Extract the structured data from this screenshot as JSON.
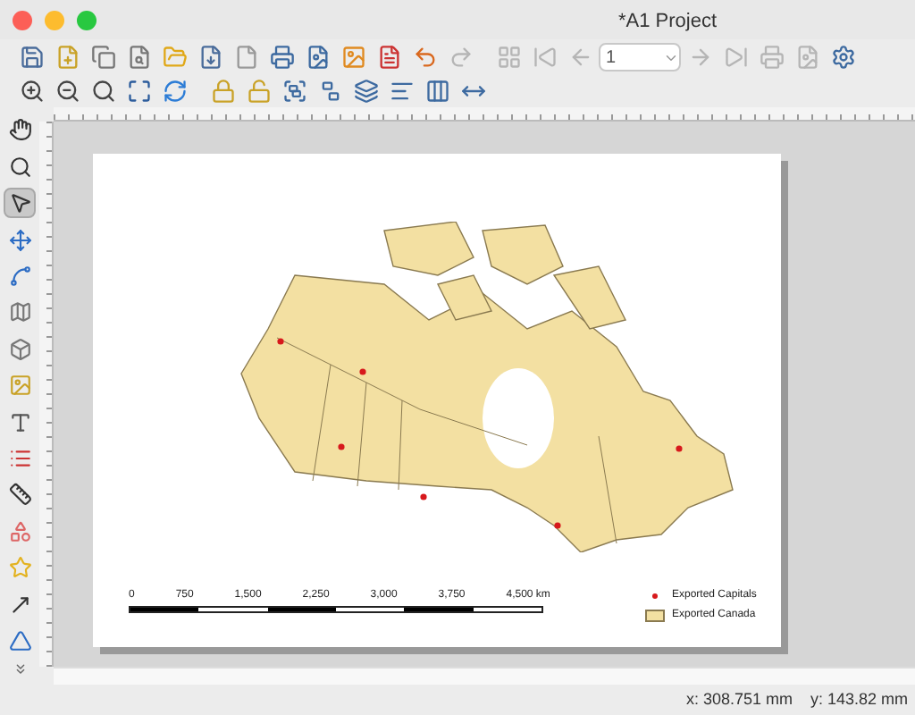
{
  "window": {
    "title": "*A1 Project"
  },
  "redo": {
    "disabled": true
  },
  "atlas": {
    "disabled": true,
    "page": "1"
  },
  "tools": [
    {
      "selected": false
    },
    {
      "selected": false
    },
    {
      "selected": true
    },
    {
      "selected": false
    },
    {
      "selected": false
    },
    {
      "selected": false
    },
    {
      "selected": false
    },
    {
      "selected": false
    },
    {
      "selected": false
    },
    {
      "selected": false
    },
    {
      "selected": false
    },
    {
      "selected": false
    },
    {
      "selected": false
    },
    {
      "selected": false
    },
    {
      "selected": false
    }
  ],
  "layout": {
    "scale_bar": {
      "labels": [
        "0",
        "750",
        "1,500",
        "2,250",
        "3,000",
        "3,750",
        "4,500 km"
      ]
    },
    "legend": [
      {
        "kind": "point",
        "label": "Exported Capitals",
        "color": "#d7191c"
      },
      {
        "kind": "polygon",
        "label": "Exported Canada",
        "color": "#f3e0a2"
      }
    ]
  },
  "status_bar": {
    "x": "x: 308.751 mm",
    "y": "y: 143.82 mm"
  }
}
